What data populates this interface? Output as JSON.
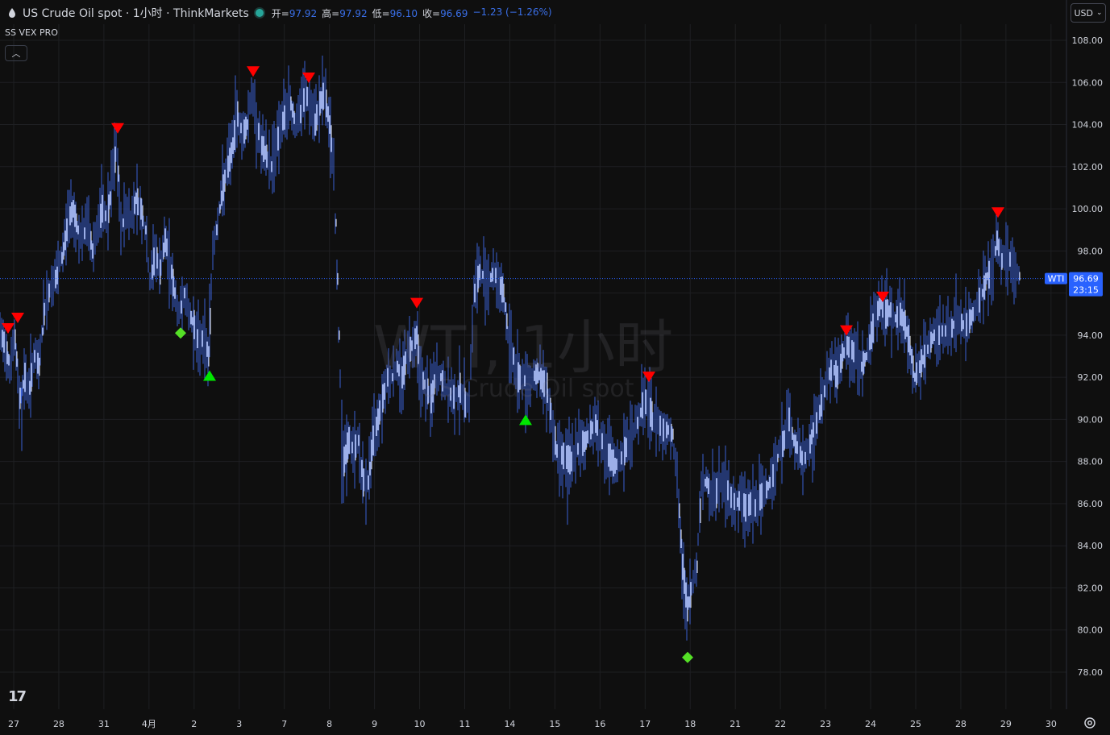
{
  "header": {
    "symbol_title": "US Crude Oil spot · 1小时 · ThinkMarkets",
    "ohlc": [
      {
        "key": "开=",
        "value": "97.92"
      },
      {
        "key": "高=",
        "value": "97.92"
      },
      {
        "key": "低=",
        "value": "96.10"
      },
      {
        "key": "收=",
        "value": "96.69"
      },
      {
        "key": "",
        "value": "−1.23 (−1.26%)"
      }
    ]
  },
  "indicator_label": "SS VEX PRO",
  "currency": "USD",
  "watermark": {
    "line1": "WTI, 1小时",
    "line2": "US Crude Oil spot"
  },
  "logo_text": "17",
  "colors": {
    "bar": "#3a5fd0",
    "wick_white": "#ffffff",
    "sell": "#ff0000",
    "buy": "#00e600",
    "diamond": "#55e026",
    "price_line": "#2962ff",
    "bg": "#0f0f0f",
    "grid": "#1e1f22"
  },
  "chart_data": {
    "type": "line",
    "title": "",
    "ylim": [
      76.5,
      109.5
    ],
    "y_ticks": [
      "108.00",
      "106.00",
      "104.00",
      "102.00",
      "100.00",
      "98.00",
      "96.00",
      "94.00",
      "92.00",
      "90.00",
      "88.00",
      "86.00",
      "84.00",
      "82.00",
      "80.00",
      "78.00"
    ],
    "x_ticks": [
      "27",
      "28",
      "31",
      "4月",
      "2",
      "3",
      "7",
      "8",
      "9",
      "10",
      "11",
      "14",
      "15",
      "16",
      "17",
      "18",
      "21",
      "22",
      "23",
      "24",
      "25",
      "28",
      "29",
      "30"
    ],
    "last_price": {
      "symbol": "WTI",
      "value": "96.69",
      "countdown": "23:15",
      "y": 96.69
    },
    "series": [
      {
        "values": [
          [
            0,
            94
          ],
          [
            6,
            93.5
          ],
          [
            12,
            92.5
          ],
          [
            18,
            93.8
          ],
          [
            24,
            91
          ],
          [
            30,
            92
          ],
          [
            36,
            91.5
          ],
          [
            42,
            93
          ],
          [
            48,
            92.5
          ],
          [
            54,
            95
          ],
          [
            60,
            96
          ],
          [
            66,
            96.5
          ],
          [
            72,
            97
          ],
          [
            78,
            98
          ],
          [
            84,
            99.5
          ],
          [
            90,
            100
          ],
          [
            96,
            99
          ],
          [
            102,
            98.5
          ],
          [
            108,
            99.5
          ],
          [
            114,
            98
          ],
          [
            120,
            99
          ],
          [
            126,
            100
          ],
          [
            132,
            99.5
          ],
          [
            138,
            101
          ],
          [
            144,
            103
          ],
          [
            150,
            99
          ],
          [
            156,
            100
          ],
          [
            162,
            99.5
          ],
          [
            168,
            100.5
          ],
          [
            174,
            100
          ],
          [
            180,
            99
          ],
          [
            186,
            96.5
          ],
          [
            192,
            98
          ],
          [
            198,
            97
          ],
          [
            204,
            98.5
          ],
          [
            210,
            97.5
          ],
          [
            216,
            96
          ],
          [
            222,
            95
          ],
          [
            228,
            96
          ],
          [
            234,
            95
          ],
          [
            240,
            94.5
          ],
          [
            246,
            93.5
          ],
          [
            252,
            94
          ],
          [
            258,
            93
          ],
          [
            264,
            98
          ],
          [
            270,
            99.5
          ],
          [
            276,
            101
          ],
          [
            282,
            102
          ],
          [
            288,
            103
          ],
          [
            294,
            104.5
          ],
          [
            300,
            103.5
          ],
          [
            306,
            104
          ],
          [
            312,
            105.5
          ],
          [
            318,
            104
          ],
          [
            324,
            103
          ],
          [
            330,
            102.5
          ],
          [
            336,
            102
          ],
          [
            342,
            103
          ],
          [
            348,
            104
          ],
          [
            354,
            104.5
          ],
          [
            360,
            105
          ],
          [
            366,
            104
          ],
          [
            372,
            104.5
          ],
          [
            378,
            105.5
          ],
          [
            384,
            105
          ],
          [
            390,
            104
          ],
          [
            396,
            105
          ],
          [
            402,
            105.5
          ],
          [
            408,
            104
          ],
          [
            414,
            102
          ],
          [
            420,
            94
          ],
          [
            426,
            88
          ],
          [
            432,
            89
          ],
          [
            438,
            88.5
          ],
          [
            444,
            89
          ],
          [
            450,
            87
          ],
          [
            456,
            87
          ],
          [
            462,
            89
          ],
          [
            468,
            90
          ],
          [
            474,
            91
          ],
          [
            480,
            92
          ],
          [
            486,
            92
          ],
          [
            492,
            92.5
          ],
          [
            498,
            92
          ],
          [
            504,
            93
          ],
          [
            510,
            93.5
          ],
          [
            516,
            94
          ],
          [
            522,
            92
          ],
          [
            528,
            91.5
          ],
          [
            534,
            91
          ],
          [
            540,
            92
          ],
          [
            546,
            92
          ],
          [
            552,
            91.5
          ],
          [
            558,
            91.2
          ],
          [
            564,
            91
          ],
          [
            570,
            91.5
          ],
          [
            576,
            90.8
          ],
          [
            582,
            91
          ],
          [
            588,
            96
          ],
          [
            594,
            97
          ],
          [
            600,
            96.8
          ],
          [
            606,
            96.6
          ],
          [
            612,
            97
          ],
          [
            618,
            96.5
          ],
          [
            624,
            96
          ],
          [
            630,
            94
          ],
          [
            636,
            93
          ],
          [
            642,
            92
          ],
          [
            648,
            92
          ],
          [
            654,
            91.5
          ],
          [
            660,
            92
          ],
          [
            666,
            92.2
          ],
          [
            672,
            91.8
          ],
          [
            678,
            91.5
          ],
          [
            684,
            90
          ],
          [
            690,
            88.5
          ],
          [
            696,
            88.3
          ],
          [
            702,
            88.2
          ],
          [
            708,
            88
          ],
          [
            714,
            88.5
          ],
          [
            720,
            88.8
          ],
          [
            726,
            89
          ],
          [
            732,
            89.5
          ],
          [
            738,
            89.8
          ],
          [
            744,
            89.2
          ],
          [
            750,
            88.5
          ],
          [
            756,
            88.2
          ],
          [
            762,
            87.8
          ],
          [
            768,
            88
          ],
          [
            774,
            88.5
          ],
          [
            780,
            89
          ],
          [
            786,
            89.5
          ],
          [
            792,
            90
          ],
          [
            798,
            91
          ],
          [
            804,
            90.5
          ],
          [
            810,
            90
          ],
          [
            816,
            89.8
          ],
          [
            822,
            89.5
          ],
          [
            828,
            89.5
          ],
          [
            834,
            89.3
          ],
          [
            840,
            87
          ],
          [
            846,
            83
          ],
          [
            852,
            81
          ],
          [
            858,
            82
          ],
          [
            864,
            83
          ],
          [
            870,
            87
          ],
          [
            876,
            87
          ],
          [
            882,
            86.5
          ],
          [
            888,
            86.5
          ],
          [
            894,
            87
          ],
          [
            900,
            86.8
          ],
          [
            906,
            86.3
          ],
          [
            912,
            86
          ],
          [
            918,
            86.2
          ],
          [
            924,
            85.8
          ],
          [
            930,
            86
          ],
          [
            936,
            85.8
          ],
          [
            942,
            86.3
          ],
          [
            948,
            86.5
          ],
          [
            954,
            87
          ],
          [
            960,
            87.5
          ],
          [
            966,
            88.5
          ],
          [
            972,
            89
          ],
          [
            978,
            90
          ],
          [
            984,
            89
          ],
          [
            990,
            88.5
          ],
          [
            996,
            88
          ],
          [
            1002,
            88.5
          ],
          [
            1008,
            89.5
          ],
          [
            1014,
            90
          ],
          [
            1020,
            91
          ],
          [
            1026,
            92
          ],
          [
            1032,
            92.5
          ],
          [
            1038,
            92
          ],
          [
            1044,
            93
          ],
          [
            1050,
            93.5
          ],
          [
            1056,
            93.3
          ],
          [
            1062,
            93
          ],
          [
            1068,
            92.5
          ],
          [
            1074,
            93
          ],
          [
            1080,
            94
          ],
          [
            1086,
            95
          ],
          [
            1092,
            95.5
          ],
          [
            1098,
            95
          ],
          [
            1104,
            95.2
          ],
          [
            1110,
            94.8
          ],
          [
            1116,
            95
          ],
          [
            1122,
            94.5
          ],
          [
            1128,
            93.5
          ],
          [
            1134,
            92
          ],
          [
            1140,
            92.5
          ],
          [
            1146,
            93
          ],
          [
            1152,
            93.5
          ],
          [
            1158,
            94
          ],
          [
            1164,
            94
          ],
          [
            1170,
            94.3
          ],
          [
            1176,
            94
          ],
          [
            1182,
            94.5
          ],
          [
            1188,
            94.8
          ],
          [
            1194,
            94.5
          ],
          [
            1200,
            94.5
          ],
          [
            1206,
            95
          ],
          [
            1212,
            95.5
          ],
          [
            1218,
            96
          ],
          [
            1224,
            96.8
          ],
          [
            1230,
            97
          ],
          [
            1236,
            98.5
          ],
          [
            1242,
            97.5
          ],
          [
            1248,
            97.8
          ],
          [
            1254,
            97.5
          ],
          [
            1260,
            97
          ],
          [
            1266,
            96.7
          ]
        ]
      }
    ],
    "signals": [
      {
        "kind": "sell",
        "x": 10,
        "y": 94.3
      },
      {
        "kind": "sell",
        "x": 22,
        "y": 94.8
      },
      {
        "kind": "sell",
        "x": 146,
        "y": 103.8
      },
      {
        "kind": "sell",
        "x": 314,
        "y": 106.5
      },
      {
        "kind": "sell",
        "x": 383,
        "y": 106.2
      },
      {
        "kind": "sell",
        "x": 517,
        "y": 95.5
      },
      {
        "kind": "sell",
        "x": 805,
        "y": 92.0
      },
      {
        "kind": "sell",
        "x": 1050,
        "y": 94.2
      },
      {
        "kind": "sell",
        "x": 1095,
        "y": 95.8
      },
      {
        "kind": "sell",
        "x": 1238,
        "y": 99.8
      },
      {
        "kind": "buy",
        "x": 260,
        "y": 92.1
      },
      {
        "kind": "buy",
        "x": 652,
        "y": 90.0
      },
      {
        "kind": "diamond",
        "x": 224,
        "y": 94.1
      },
      {
        "kind": "diamond",
        "x": 853,
        "y": 78.7
      }
    ]
  }
}
